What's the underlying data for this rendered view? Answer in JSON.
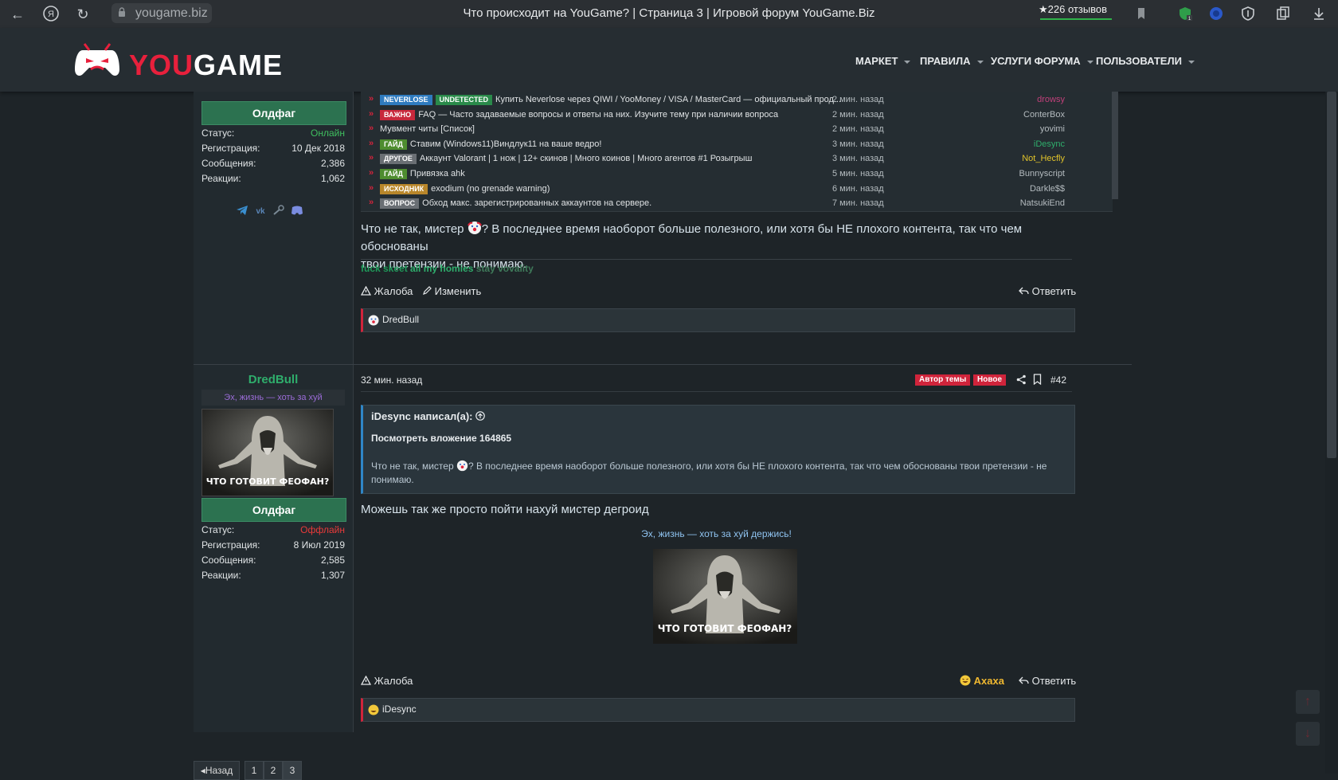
{
  "browser": {
    "url": "yougame.biz",
    "tab_title": "Что происходит на YouGame? | Страница 3 | Игровой форум YouGame.Biz",
    "reviews": "★226 отзывов"
  },
  "site": {
    "logo_you": "YOU",
    "logo_game": "GAME",
    "nav": [
      "МАРКЕТ",
      "ПРАВИЛА",
      "УСЛУГИ ФОРУМА",
      "ПОЛЬЗОВАТЕЛИ"
    ]
  },
  "threads": [
    {
      "tags": [
        {
          "t": "NEVERLOSE",
          "c": "#2f7bbf"
        },
        {
          "t": "UNDETECTED",
          "c": "#2a8a4a"
        }
      ],
      "title": "Купить Neverlose через QIWI / YooMoney / VISA / MasterCard — официальный прод...",
      "time": "2 мин. назад",
      "user": "drowsy",
      "ucolor": "#c0407a"
    },
    {
      "tags": [
        {
          "t": "ВАЖНО",
          "c": "#c8283c"
        }
      ],
      "title": "FAQ — Часто задаваемые вопросы и ответы на них. Изучите тему при наличии вопроса",
      "time": "2 мин. назад",
      "user": "ConterBox",
      "ucolor": "#b4bbbf"
    },
    {
      "tags": [],
      "title": "Мувмент читы [Список]",
      "time": "2 мин. назад",
      "user": "yovimi",
      "ucolor": "#b4bbbf"
    },
    {
      "tags": [
        {
          "t": "ГАЙД",
          "c": "#4e8d2f"
        }
      ],
      "title": "Ставим (Windows11)Виндлук11 на ваше ведро!",
      "time": "3 мин. назад",
      "user": "iDesync",
      "ucolor": "#2fae6c"
    },
    {
      "tags": [
        {
          "t": "ДРУГОЕ",
          "c": "#6a6f74"
        }
      ],
      "title": "Аккаунт Valorant | 1 нож | 12+ скинов | Много коинов | Много агентов #1 Розыгрыш",
      "time": "3 мин. назад",
      "user": "Not_Hecfly",
      "ucolor": "#e0c32a"
    },
    {
      "tags": [
        {
          "t": "ГАЙД",
          "c": "#4e8d2f"
        }
      ],
      "title": "Привязка ahk",
      "time": "5 мин. назад",
      "user": "Bunnyscript",
      "ucolor": "#b4bbbf"
    },
    {
      "tags": [
        {
          "t": "ИСХОДНИК",
          "c": "#b8862a"
        }
      ],
      "title": "exodium (no grenade warning)",
      "time": "6 мин. назад",
      "user": "Darkle$$",
      "ucolor": "#b4bbbf"
    },
    {
      "tags": [
        {
          "t": "ВОПРОС",
          "c": "#6a6f74"
        }
      ],
      "title": "Обход макс. зарегистрированных аккаунтов на сервере.",
      "time": "7 мин. назад",
      "user": "NatsukiEnd",
      "ucolor": "#b4bbbf"
    }
  ],
  "post1": {
    "group": "Олдфаг",
    "status_label": "Статус:",
    "status": "Онлайн",
    "reg_label": "Регистрация:",
    "reg": "10 Дек 2018",
    "msgs_label": "Сообщения:",
    "msgs": "2,386",
    "reacts_label": "Реакции:",
    "reacts": "1,062",
    "text_a": "Что не так, мистер ",
    "text_b": "? В последнее время наоборот больше полезного, или хотя бы НЕ плохого контента, так что чем обоснованы",
    "text_c": "твои претензии - не понимаю.",
    "sig": [
      {
        "t": "fuck skeet",
        "c": "#1f9a5a"
      },
      {
        "t": "all my homies",
        "c": "#2fae6c"
      },
      {
        "t": "stay vovality",
        "c": "#3f7a5a"
      }
    ],
    "report": "Жалоба",
    "edit": "Изменить",
    "reply": "Ответить",
    "reaction_user": "DredBull"
  },
  "post2": {
    "username": "DredBull",
    "user_title": "Эх, жизнь — хоть за хуй",
    "avatar_caption": "ЧТО ГОТОВИТ ФЕОФАН?",
    "group": "Олдфаг",
    "status_label": "Статус:",
    "status": "Оффлайн",
    "reg_label": "Регистрация:",
    "reg": "8 Июл 2019",
    "msgs_label": "Сообщения:",
    "msgs": "2,585",
    "reacts_label": "Реакции:",
    "reacts": "1,307",
    "time": "32 мин. назад",
    "author_badge": "Автор темы",
    "new_badge": "Новое",
    "post_number": "#42",
    "quote_head": "iDesync написал(а):",
    "quote_attachment": "Посмотреть вложение 164865",
    "quote_text_a": "Что не так, мистер ",
    "quote_text_b": "? В последнее время наоборот больше полезного, или хотя бы НЕ плохого контента, так что чем обоснованы твои претензии - не понимаю.",
    "text": "Можешь так же просто пойти нахуй мистер дегроид",
    "sig_caption": "Эх, жизнь — хоть за хуй держись!",
    "image_caption": "ЧТО ГОТОВИТ ФЕОФАН?",
    "report": "Жалоба",
    "reaction_label": "Ахаха",
    "reply": "Ответить",
    "reaction_user": "iDesync"
  },
  "pagination": {
    "prev": "◂Назад",
    "pages": [
      "1",
      "2",
      "3"
    ]
  },
  "colors": {
    "accent": "#d0243b",
    "green": "#2c7250",
    "bg": "#1e2428"
  }
}
